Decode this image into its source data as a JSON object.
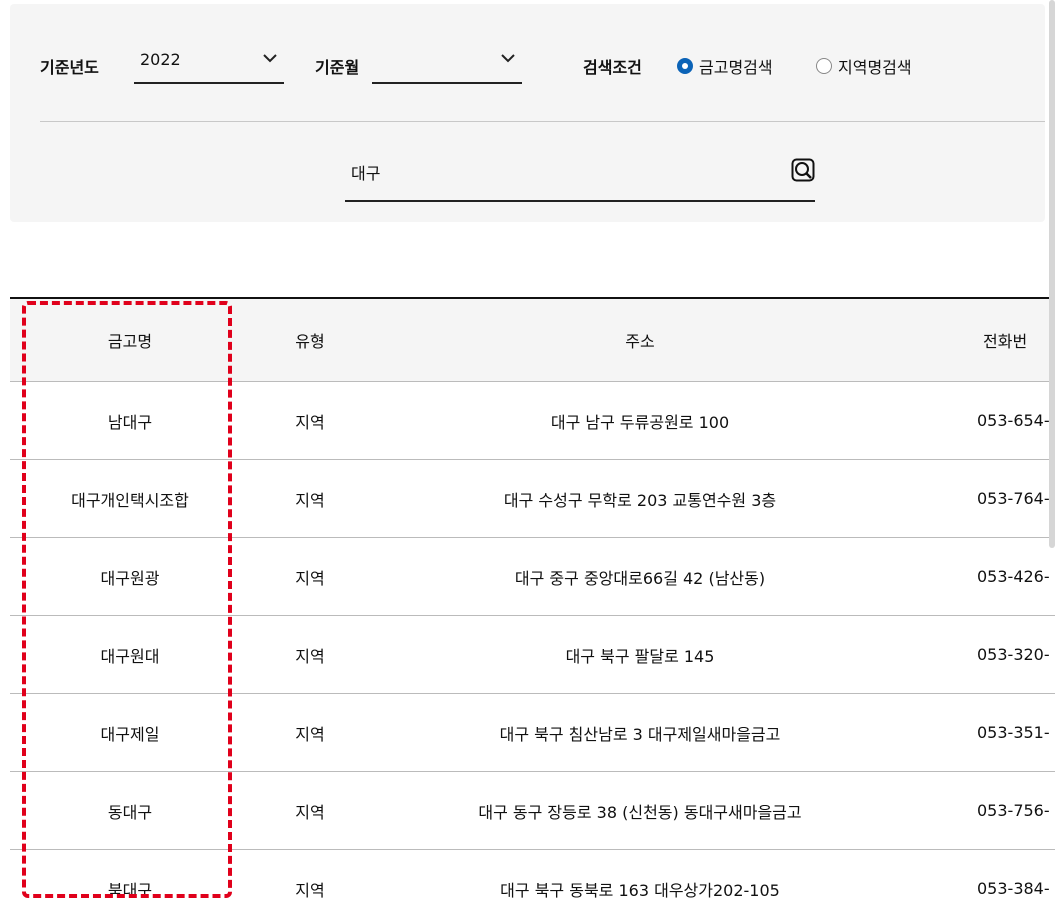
{
  "filters": {
    "year_label": "기준년도",
    "year_value": "2022",
    "month_label": "기준월",
    "month_value": "",
    "condition_label": "검색조건",
    "radio_name": "금고명검색",
    "radio_region": "지역명검색",
    "selected": "name"
  },
  "search": {
    "value": "대구",
    "icon": "search-icon"
  },
  "table": {
    "headers": [
      "금고명",
      "유형",
      "주소",
      "전화번"
    ],
    "rows": [
      {
        "name": "남대구",
        "type": "지역",
        "address": "대구 남구 두류공원로 100",
        "phone": "053-654-"
      },
      {
        "name": "대구개인택시조합",
        "type": "지역",
        "address": "대구 수성구 무학로 203 교통연수원 3층",
        "phone": "053-764-"
      },
      {
        "name": "대구원광",
        "type": "지역",
        "address": "대구 중구 중앙대로66길 42 (남산동)",
        "phone": "053-426-"
      },
      {
        "name": "대구원대",
        "type": "지역",
        "address": "대구 북구 팔달로 145",
        "phone": "053-320-"
      },
      {
        "name": "대구제일",
        "type": "지역",
        "address": "대구 북구 침산남로 3 대구제일새마을금고",
        "phone": "053-351-"
      },
      {
        "name": "동대구",
        "type": "지역",
        "address": "대구 동구 장등로 38 (신천동) 동대구새마을금고",
        "phone": "053-756-"
      },
      {
        "name": "북대구",
        "type": "지역",
        "address": "대구 북구 동북로 163 대우상가202-105",
        "phone": "053-384-"
      }
    ]
  },
  "colors": {
    "accent": "#0b63b7",
    "highlight": "#e0001b"
  }
}
